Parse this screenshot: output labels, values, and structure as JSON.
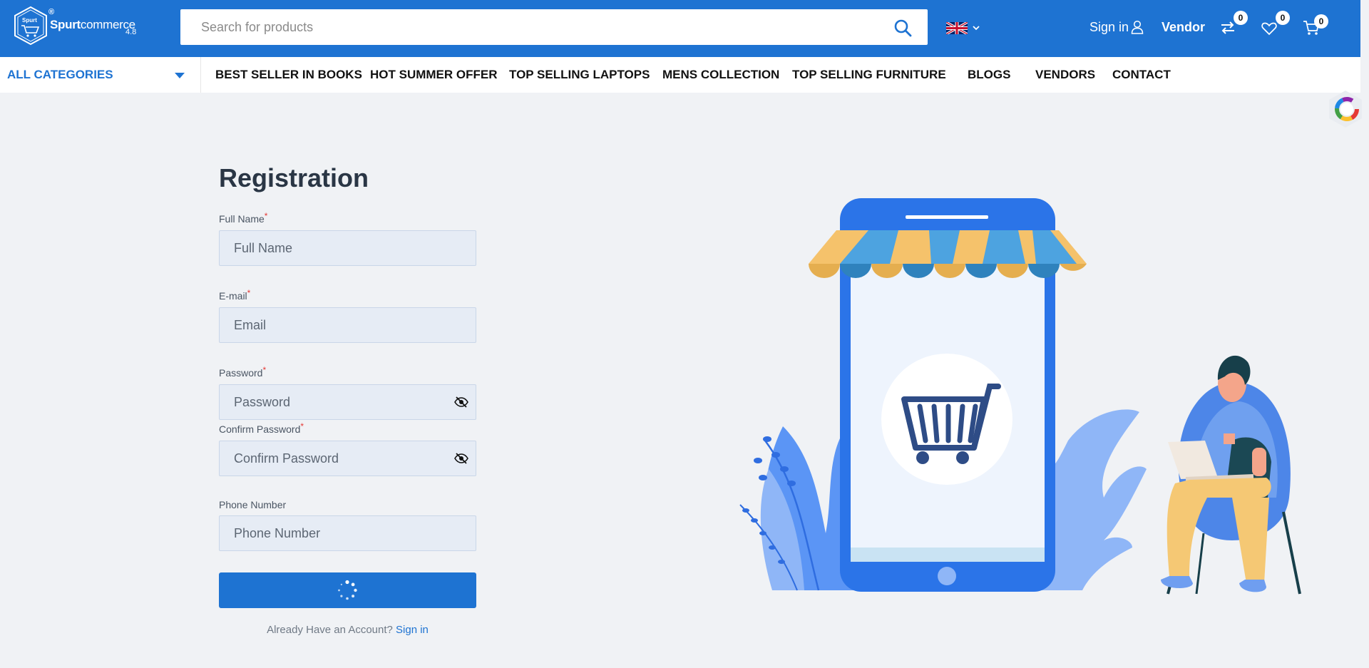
{
  "brand": {
    "name_bold": "Spurt",
    "name_light": "commerce",
    "version": "4.8",
    "registered": "®",
    "badge_text": "Spurt"
  },
  "search": {
    "placeholder": "Search for products",
    "icon": "search-icon"
  },
  "header": {
    "language_flag": "uk-flag-icon",
    "signin_label": "Sign in",
    "vendor_label": "Vendor",
    "compare_count": "0",
    "wishlist_count": "0",
    "cart_count": "0"
  },
  "nav": {
    "all_categories": "ALL CATEGORIES",
    "links": [
      "BEST SELLER IN BOOKS",
      "HOT SUMMER OFFER",
      "TOP SELLING LAPTOPS",
      "MENS COLLECTION",
      "TOP SELLING FURNITURE",
      "BLOGS",
      "VENDORS",
      "CONTACT"
    ]
  },
  "form": {
    "title": "Registration",
    "required_mark": "*",
    "full_name": {
      "label": "Full Name",
      "placeholder": "Full Name"
    },
    "email": {
      "label": "E-mail",
      "placeholder": "Email"
    },
    "password": {
      "label": "Password",
      "placeholder": "Password"
    },
    "confirm_password": {
      "label": "Confirm Password",
      "placeholder": "Confirm Password"
    },
    "phone": {
      "label": "Phone Number",
      "placeholder": "Phone Number"
    },
    "already_text": "Already Have an Account?",
    "signin_link": "Sign in"
  },
  "colors": {
    "primary": "#1e73d2",
    "background": "#f0f2f5",
    "input_bg": "#e6ecf5",
    "required": "#e53935"
  }
}
